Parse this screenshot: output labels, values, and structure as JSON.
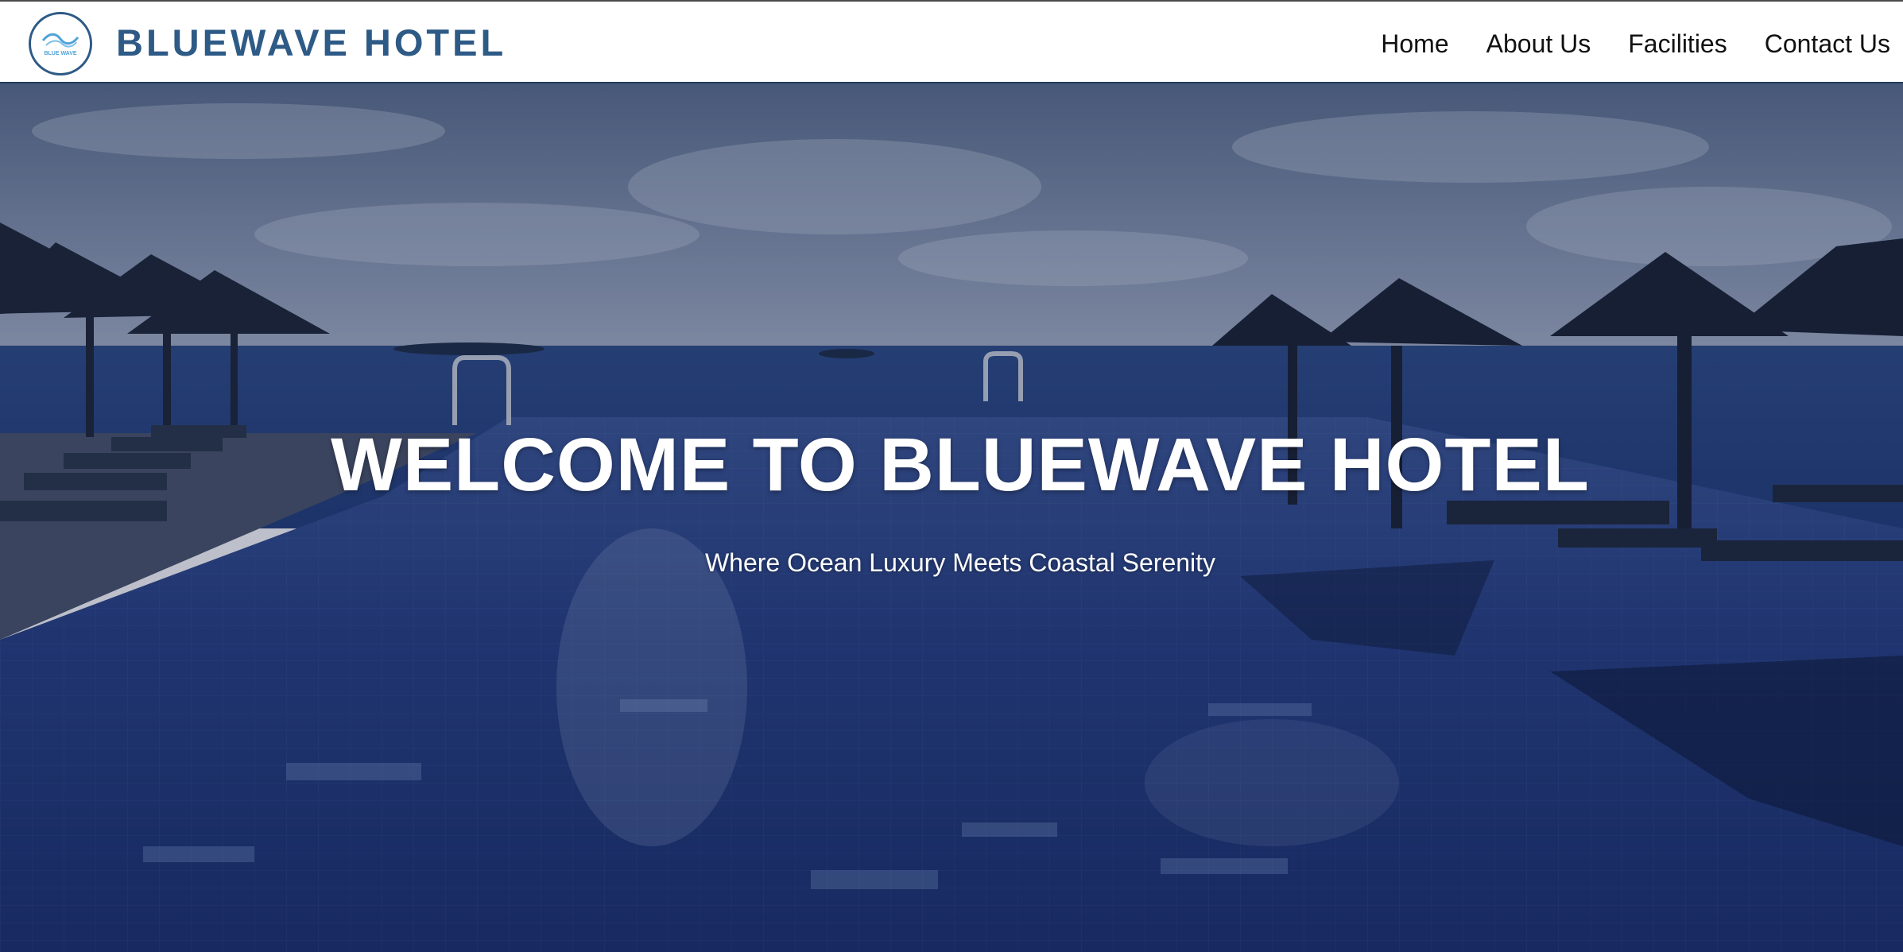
{
  "header": {
    "brand": "BLUEWAVE HOTEL",
    "logo_text": "BLUE WAVE",
    "nav": [
      {
        "label": "Home"
      },
      {
        "label": "About Us"
      },
      {
        "label": "Facilities"
      },
      {
        "label": "Contact Us"
      }
    ]
  },
  "hero": {
    "title": "WELCOME TO BLUEWAVE HOTEL",
    "subtitle": "Where Ocean Luxury Meets Coastal Serenity",
    "image_icon": "pool-ocean-image"
  },
  "colors": {
    "brand": "#2e5a86",
    "nav_text": "#111111",
    "hero_text": "#ffffff"
  }
}
